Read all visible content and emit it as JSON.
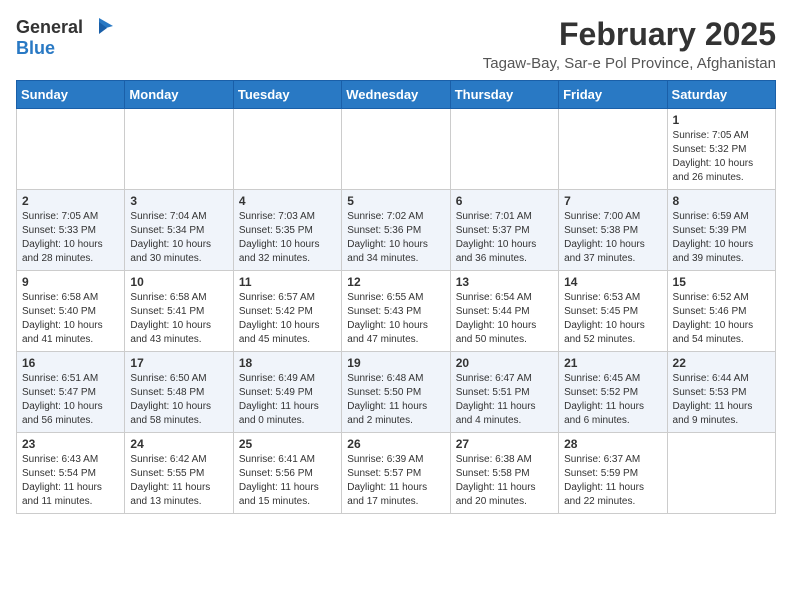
{
  "header": {
    "logo_general": "General",
    "logo_blue": "Blue",
    "month_year": "February 2025",
    "location": "Tagaw-Bay, Sar-e Pol Province, Afghanistan"
  },
  "days_of_week": [
    "Sunday",
    "Monday",
    "Tuesday",
    "Wednesday",
    "Thursday",
    "Friday",
    "Saturday"
  ],
  "weeks": [
    [
      {
        "day": "",
        "info": ""
      },
      {
        "day": "",
        "info": ""
      },
      {
        "day": "",
        "info": ""
      },
      {
        "day": "",
        "info": ""
      },
      {
        "day": "",
        "info": ""
      },
      {
        "day": "",
        "info": ""
      },
      {
        "day": "1",
        "info": "Sunrise: 7:05 AM\nSunset: 5:32 PM\nDaylight: 10 hours and 26 minutes."
      }
    ],
    [
      {
        "day": "2",
        "info": "Sunrise: 7:05 AM\nSunset: 5:33 PM\nDaylight: 10 hours and 28 minutes."
      },
      {
        "day": "3",
        "info": "Sunrise: 7:04 AM\nSunset: 5:34 PM\nDaylight: 10 hours and 30 minutes."
      },
      {
        "day": "4",
        "info": "Sunrise: 7:03 AM\nSunset: 5:35 PM\nDaylight: 10 hours and 32 minutes."
      },
      {
        "day": "5",
        "info": "Sunrise: 7:02 AM\nSunset: 5:36 PM\nDaylight: 10 hours and 34 minutes."
      },
      {
        "day": "6",
        "info": "Sunrise: 7:01 AM\nSunset: 5:37 PM\nDaylight: 10 hours and 36 minutes."
      },
      {
        "day": "7",
        "info": "Sunrise: 7:00 AM\nSunset: 5:38 PM\nDaylight: 10 hours and 37 minutes."
      },
      {
        "day": "8",
        "info": "Sunrise: 6:59 AM\nSunset: 5:39 PM\nDaylight: 10 hours and 39 minutes."
      }
    ],
    [
      {
        "day": "9",
        "info": "Sunrise: 6:58 AM\nSunset: 5:40 PM\nDaylight: 10 hours and 41 minutes."
      },
      {
        "day": "10",
        "info": "Sunrise: 6:58 AM\nSunset: 5:41 PM\nDaylight: 10 hours and 43 minutes."
      },
      {
        "day": "11",
        "info": "Sunrise: 6:57 AM\nSunset: 5:42 PM\nDaylight: 10 hours and 45 minutes."
      },
      {
        "day": "12",
        "info": "Sunrise: 6:55 AM\nSunset: 5:43 PM\nDaylight: 10 hours and 47 minutes."
      },
      {
        "day": "13",
        "info": "Sunrise: 6:54 AM\nSunset: 5:44 PM\nDaylight: 10 hours and 50 minutes."
      },
      {
        "day": "14",
        "info": "Sunrise: 6:53 AM\nSunset: 5:45 PM\nDaylight: 10 hours and 52 minutes."
      },
      {
        "day": "15",
        "info": "Sunrise: 6:52 AM\nSunset: 5:46 PM\nDaylight: 10 hours and 54 minutes."
      }
    ],
    [
      {
        "day": "16",
        "info": "Sunrise: 6:51 AM\nSunset: 5:47 PM\nDaylight: 10 hours and 56 minutes."
      },
      {
        "day": "17",
        "info": "Sunrise: 6:50 AM\nSunset: 5:48 PM\nDaylight: 10 hours and 58 minutes."
      },
      {
        "day": "18",
        "info": "Sunrise: 6:49 AM\nSunset: 5:49 PM\nDaylight: 11 hours and 0 minutes."
      },
      {
        "day": "19",
        "info": "Sunrise: 6:48 AM\nSunset: 5:50 PM\nDaylight: 11 hours and 2 minutes."
      },
      {
        "day": "20",
        "info": "Sunrise: 6:47 AM\nSunset: 5:51 PM\nDaylight: 11 hours and 4 minutes."
      },
      {
        "day": "21",
        "info": "Sunrise: 6:45 AM\nSunset: 5:52 PM\nDaylight: 11 hours and 6 minutes."
      },
      {
        "day": "22",
        "info": "Sunrise: 6:44 AM\nSunset: 5:53 PM\nDaylight: 11 hours and 9 minutes."
      }
    ],
    [
      {
        "day": "23",
        "info": "Sunrise: 6:43 AM\nSunset: 5:54 PM\nDaylight: 11 hours and 11 minutes."
      },
      {
        "day": "24",
        "info": "Sunrise: 6:42 AM\nSunset: 5:55 PM\nDaylight: 11 hours and 13 minutes."
      },
      {
        "day": "25",
        "info": "Sunrise: 6:41 AM\nSunset: 5:56 PM\nDaylight: 11 hours and 15 minutes."
      },
      {
        "day": "26",
        "info": "Sunrise: 6:39 AM\nSunset: 5:57 PM\nDaylight: 11 hours and 17 minutes."
      },
      {
        "day": "27",
        "info": "Sunrise: 6:38 AM\nSunset: 5:58 PM\nDaylight: 11 hours and 20 minutes."
      },
      {
        "day": "28",
        "info": "Sunrise: 6:37 AM\nSunset: 5:59 PM\nDaylight: 11 hours and 22 minutes."
      },
      {
        "day": "",
        "info": ""
      }
    ]
  ]
}
